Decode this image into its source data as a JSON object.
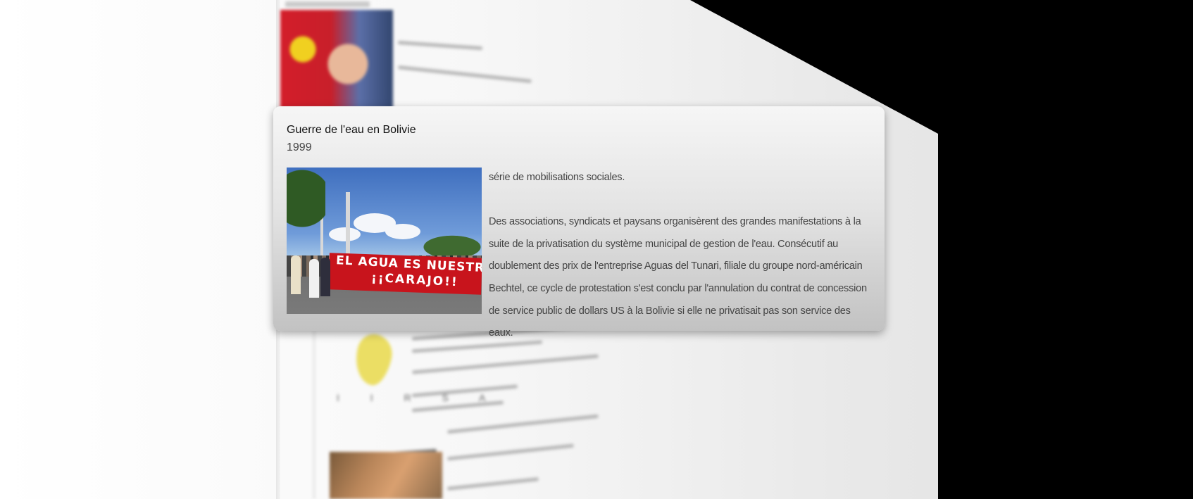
{
  "popup": {
    "title": "Guerre de l'eau en Bolivie",
    "year": "1999",
    "photo": {
      "banner_line1": "EL AGUA ES NUESTRA",
      "banner_line2": "¡¡CARAJO!!"
    },
    "paragraph1": "série de mobilisations sociales.",
    "paragraph2": "Des associations, syndicats et paysans organisèrent des grandes manifestations à la suite de la privatisation du système municipal de gestion de l'eau. Consécutif au doublement des prix de l'entreprise Aguas del Tunari, filiale du groupe nord-américain Bechtel, ce cycle de protestation s'est conclu par l'annulation du contrat de concession de service public de dollars US à la Bolivie si elle ne privatisait pas son service des eaux."
  },
  "background": {
    "map_letters": "I I R S A"
  },
  "colors": {
    "banner_red": "#c8141c",
    "card_gradient_top": "#f6f6f6",
    "card_gradient_bottom": "#c2c2c2",
    "wedge": "#000000"
  }
}
